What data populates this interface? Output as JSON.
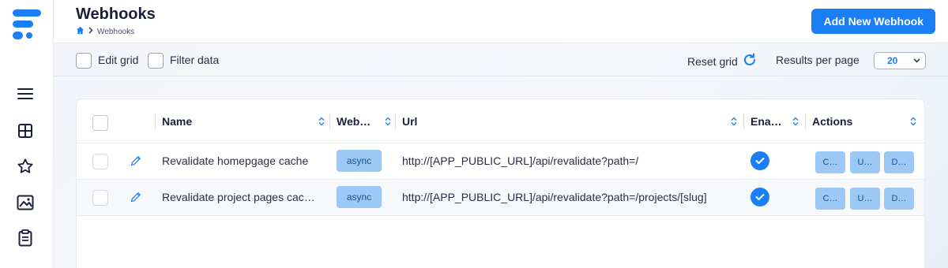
{
  "header": {
    "title": "Webhooks",
    "breadcrumb": [
      "Webhooks"
    ],
    "add_button": "Add New Webhook"
  },
  "toolbar": {
    "edit_grid": "Edit grid",
    "filter_data": "Filter data",
    "reset_grid": "Reset grid",
    "results_per_page_label": "Results per page",
    "results_per_page_value": "20"
  },
  "sidebar": {
    "icons": [
      "menu-icon",
      "grid-icon",
      "star-icon",
      "image-icon",
      "clipboard-icon"
    ]
  },
  "grid": {
    "columns": [
      "Name",
      "Web…",
      "Url",
      "Ena…",
      "Actions"
    ],
    "rows": [
      {
        "name": "Revalidate homepgage cache",
        "webhook_type": "async",
        "url": "http://[APP_PUBLIC_URL]/api/revalidate?path=/",
        "enabled": true,
        "actions": [
          "C…",
          "U…",
          "D…"
        ]
      },
      {
        "name": "Revalidate project pages cac…",
        "webhook_type": "async",
        "url": "http://[APP_PUBLIC_URL]/api/revalidate?path=/projects/[slug]",
        "enabled": true,
        "actions": [
          "C…",
          "U…",
          "D…"
        ]
      }
    ]
  },
  "colors": {
    "accent": "#1a7ef5",
    "badge": "#9cc8f6",
    "text": "#1b1e3d"
  }
}
